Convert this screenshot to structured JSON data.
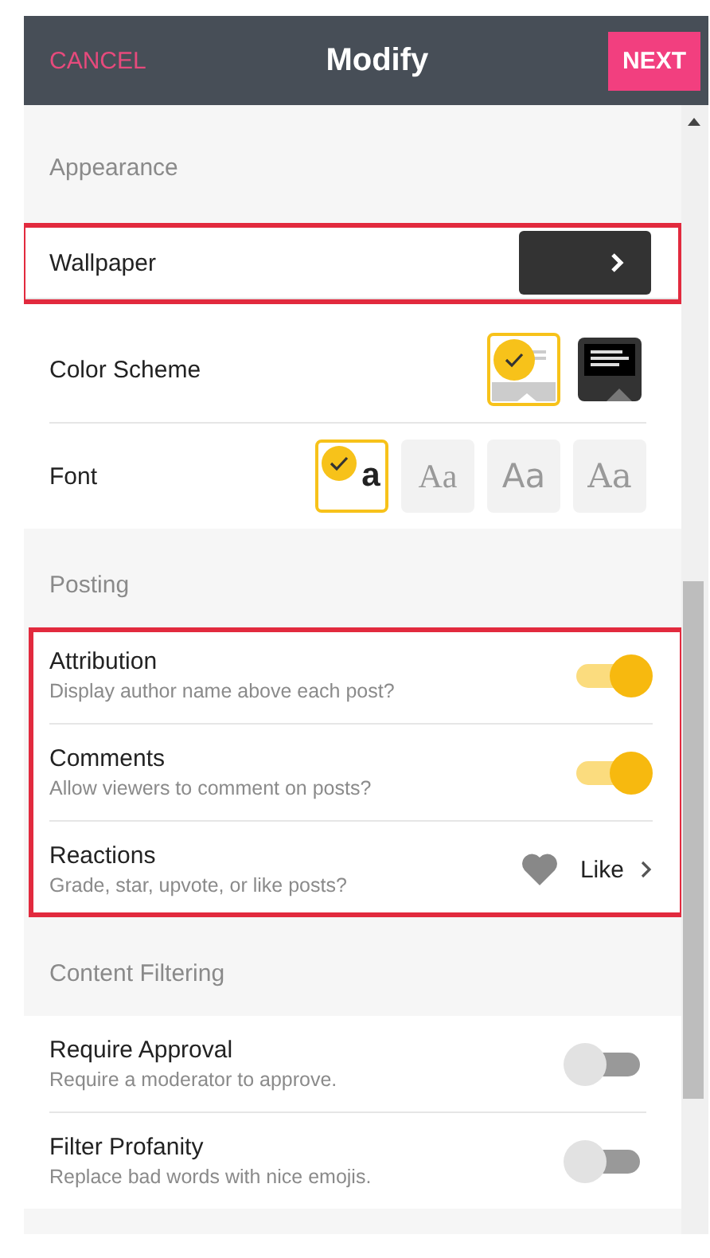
{
  "header": {
    "cancel": "CANCEL",
    "title": "Modify",
    "next": "NEXT"
  },
  "sections": [
    {
      "title": "Appearance",
      "highlighted": false,
      "rows": [
        {
          "kind": "wallpaper",
          "label": "Wallpaper",
          "highlighted": true
        },
        {
          "kind": "color_scheme",
          "label": "Color Scheme",
          "highlighted": false,
          "options": [
            {
              "kind": "light",
              "selected": true
            },
            {
              "kind": "dark",
              "selected": false
            }
          ]
        },
        {
          "kind": "font",
          "label": "Font",
          "highlighted": false,
          "options": [
            {
              "label": "a",
              "selected": true
            },
            {
              "label": "Aa",
              "selected": false
            },
            {
              "label": "Aa",
              "selected": false
            },
            {
              "label": "Aa",
              "selected": false
            }
          ]
        }
      ]
    },
    {
      "title": "Posting",
      "highlighted": true,
      "rows": [
        {
          "kind": "toggle",
          "label": "Attribution",
          "description": "Display author name above each post?",
          "on": true
        },
        {
          "kind": "toggle",
          "label": "Comments",
          "description": "Allow viewers to comment on posts?",
          "on": true
        },
        {
          "kind": "reaction",
          "label": "Reactions",
          "description": "Grade, star, upvote, or like posts?",
          "value": "Like"
        }
      ]
    },
    {
      "title": "Content Filtering",
      "highlighted": false,
      "rows": [
        {
          "kind": "toggle",
          "label": "Require Approval",
          "description": "Require a moderator to approve.",
          "on": false
        },
        {
          "kind": "toggle",
          "label": "Filter Profanity",
          "description": "Replace bad words with nice emojis.",
          "on": false
        }
      ]
    }
  ]
}
